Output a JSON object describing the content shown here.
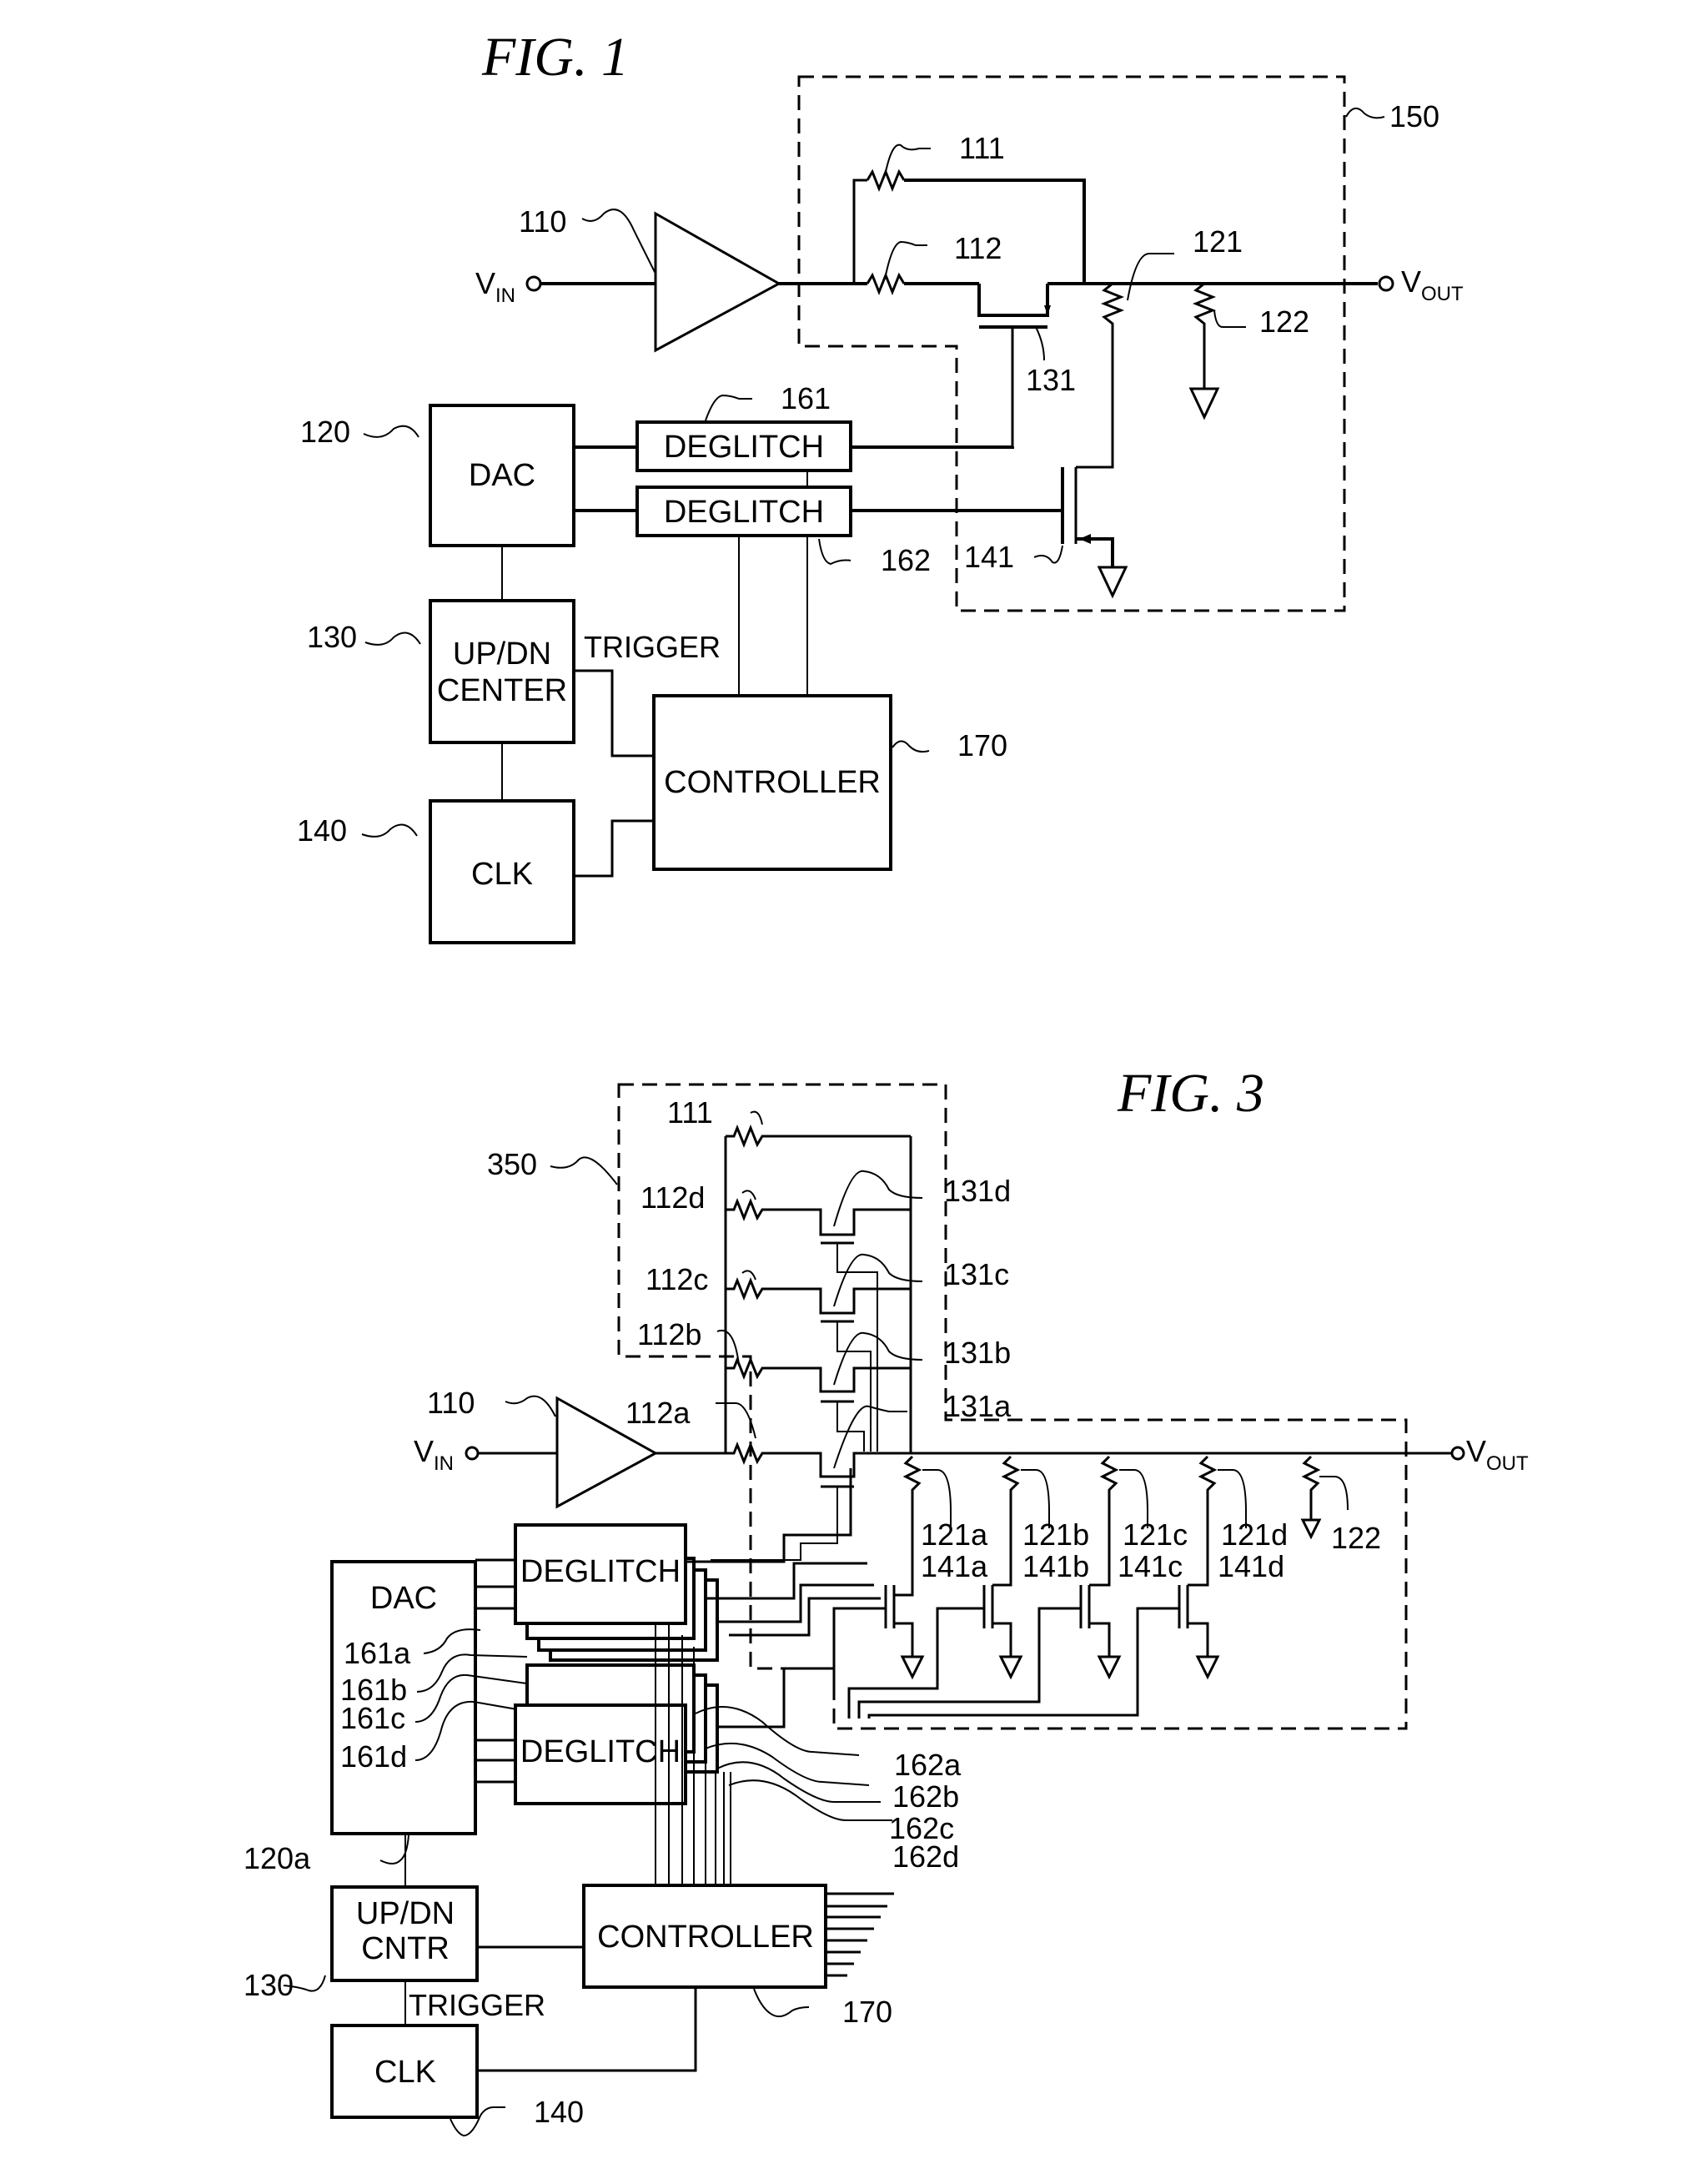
{
  "fig1": {
    "title": "FIG. 1",
    "vin": "V",
    "vin_sub": "IN",
    "vout": "V",
    "vout_sub": "OUT",
    "blocks": {
      "dac": "DAC",
      "updn_line1": "UP/DN",
      "updn_line2": "CENTER",
      "clk": "CLK",
      "controller": "CONTROLLER",
      "deglitch1": "DEGLITCH",
      "deglitch2": "DEGLITCH"
    },
    "trigger": "TRIGGER",
    "refs": {
      "amp": "110",
      "r111": "111",
      "r112": "112",
      "r121": "121",
      "r122": "122",
      "t131": "131",
      "t141": "141",
      "box150": "150",
      "dg161": "161",
      "dg162": "162",
      "dac120": "120",
      "cnt130": "130",
      "clk140": "140",
      "ctl170": "170"
    }
  },
  "fig3": {
    "title": "FIG. 3",
    "vin": "V",
    "vin_sub": "IN",
    "vout": "V",
    "vout_sub": "OUT",
    "blocks": {
      "dac": "DAC",
      "updn_line1": "UP/DN",
      "updn_line2": "CNTR",
      "clk": "CLK",
      "controller": "CONTROLLER",
      "deglitch1": "DEGLITCH",
      "deglitch2": "DEGLITCH"
    },
    "trigger": "TRIGGER",
    "refs": {
      "box350": "350",
      "r111": "111",
      "r112d": "112d",
      "r112c": "112c",
      "r112b": "112b",
      "r112a": "112a",
      "t131d": "131d",
      "t131c": "131c",
      "t131b": "131b",
      "t131a": "131a",
      "amp": "110",
      "r121a": "121a",
      "r121b": "121b",
      "r121c": "121c",
      "r121d": "121d",
      "r122": "122",
      "t141a": "141a",
      "t141b": "141b",
      "t141c": "141c",
      "t141d": "141d",
      "d161a": "161a",
      "d161b": "161b",
      "d161c": "161c",
      "d161d": "161d",
      "d162a": "162a",
      "d162b": "162b",
      "d162c": "162c",
      "d162d": "162d",
      "dac120a": "120a",
      "cnt130": "130",
      "clk140": "140",
      "ctl170": "170"
    }
  }
}
